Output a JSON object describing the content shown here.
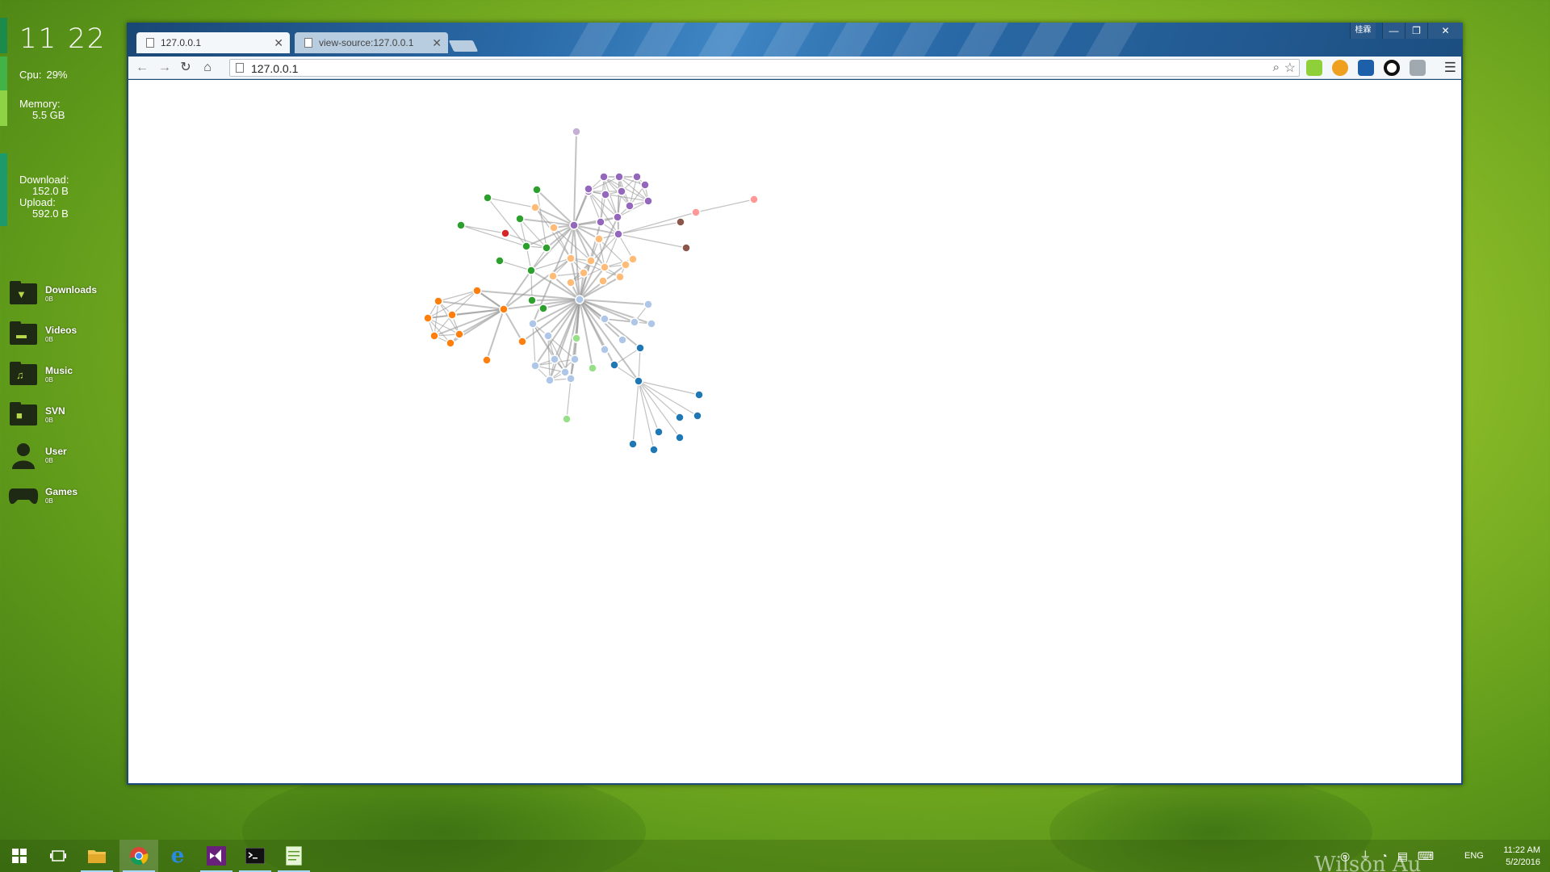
{
  "desktop": {
    "clock": "11 22",
    "cpu_label": "Cpu:",
    "cpu_value": "29%",
    "memory_label": "Memory:",
    "memory_value": "5.5 GB",
    "download_label": "Download:",
    "download_value": "152.0 B",
    "upload_label": "Upload:",
    "upload_value": "592.0 B",
    "shortcuts": [
      {
        "name": "Downloads",
        "size": "0B",
        "icon": "download-folder-icon"
      },
      {
        "name": "Videos",
        "size": "0B",
        "icon": "video-folder-icon"
      },
      {
        "name": "Music",
        "size": "0B",
        "icon": "music-folder-icon"
      },
      {
        "name": "SVN",
        "size": "0B",
        "icon": "svn-folder-icon"
      },
      {
        "name": "User",
        "size": "0B",
        "icon": "user-icon"
      },
      {
        "name": "Games",
        "size": "0B",
        "icon": "gamepad-icon"
      }
    ],
    "watermark": "Wilson Au"
  },
  "browser": {
    "tabs": [
      {
        "title": "127.0.0.1",
        "active": true
      },
      {
        "title": "view-source:127.0.0.1",
        "active": false
      }
    ],
    "user_badge": "桂霖",
    "url": "127.0.0.1"
  },
  "graph": {
    "colors": {
      "blue_dark": "#1f77b4",
      "blue_light": "#aec7e8",
      "orange": "#ff7f0e",
      "orange_light": "#ffbb78",
      "green": "#2ca02c",
      "green_light": "#98df8a",
      "red": "#d62728",
      "pink": "#ff9896",
      "purple": "#9467bd",
      "purple_light": "#c5b0d5",
      "brown": "#8c564b",
      "link": "#999999"
    },
    "nodes": [
      {
        "id": 0,
        "group": "purple_light"
      },
      {
        "id": 1,
        "group": "purple"
      },
      {
        "id": 2,
        "group": "purple"
      },
      {
        "id": 3,
        "group": "purple"
      },
      {
        "id": 4,
        "group": "purple"
      },
      {
        "id": 5,
        "group": "purple"
      },
      {
        "id": 6,
        "group": "purple"
      },
      {
        "id": 7,
        "group": "purple"
      },
      {
        "id": 8,
        "group": "purple"
      },
      {
        "id": 9,
        "group": "purple"
      },
      {
        "id": 10,
        "group": "purple"
      },
      {
        "id": 11,
        "group": "purple"
      },
      {
        "id": 12,
        "group": "purple"
      },
      {
        "id": 13,
        "group": "purple"
      },
      {
        "id": 14,
        "group": "purple"
      },
      {
        "id": 15,
        "group": "pink"
      },
      {
        "id": 16,
        "group": "pink"
      },
      {
        "id": 17,
        "group": "brown"
      },
      {
        "id": 18,
        "group": "brown"
      },
      {
        "id": 19,
        "group": "green"
      },
      {
        "id": 20,
        "group": "green"
      },
      {
        "id": 21,
        "group": "green"
      },
      {
        "id": 22,
        "group": "green"
      },
      {
        "id": 23,
        "group": "green"
      },
      {
        "id": 24,
        "group": "green"
      },
      {
        "id": 25,
        "group": "green"
      },
      {
        "id": 26,
        "group": "green"
      },
      {
        "id": 27,
        "group": "green"
      },
      {
        "id": 28,
        "group": "green"
      },
      {
        "id": 29,
        "group": "red"
      },
      {
        "id": 30,
        "group": "orange_light"
      },
      {
        "id": 31,
        "group": "orange_light"
      },
      {
        "id": 32,
        "group": "orange_light"
      },
      {
        "id": 33,
        "group": "orange_light"
      },
      {
        "id": 34,
        "group": "orange_light"
      },
      {
        "id": 35,
        "group": "orange_light"
      },
      {
        "id": 36,
        "group": "orange_light"
      },
      {
        "id": 37,
        "group": "orange_light"
      },
      {
        "id": 38,
        "group": "orange_light"
      },
      {
        "id": 39,
        "group": "orange_light"
      },
      {
        "id": 40,
        "group": "orange_light"
      },
      {
        "id": 41,
        "group": "orange_light"
      },
      {
        "id": 42,
        "group": "orange_light"
      },
      {
        "id": 43,
        "group": "orange"
      },
      {
        "id": 44,
        "group": "orange"
      },
      {
        "id": 45,
        "group": "orange"
      },
      {
        "id": 46,
        "group": "orange"
      },
      {
        "id": 47,
        "group": "orange"
      },
      {
        "id": 48,
        "group": "orange"
      },
      {
        "id": 49,
        "group": "orange"
      },
      {
        "id": 50,
        "group": "orange"
      },
      {
        "id": 51,
        "group": "orange"
      },
      {
        "id": 52,
        "group": "orange"
      },
      {
        "id": 53,
        "group": "blue_light"
      },
      {
        "id": 54,
        "group": "blue_light"
      },
      {
        "id": 55,
        "group": "blue_light"
      },
      {
        "id": 56,
        "group": "blue_light"
      },
      {
        "id": 57,
        "group": "blue_light"
      },
      {
        "id": 58,
        "group": "blue_light"
      },
      {
        "id": 59,
        "group": "blue_light"
      },
      {
        "id": 60,
        "group": "blue_light"
      },
      {
        "id": 61,
        "group": "blue_light"
      },
      {
        "id": 62,
        "group": "blue_light"
      },
      {
        "id": 63,
        "group": "blue_light"
      },
      {
        "id": 64,
        "group": "blue_light"
      },
      {
        "id": 65,
        "group": "blue_light"
      },
      {
        "id": 66,
        "group": "blue_light"
      },
      {
        "id": 67,
        "group": "blue_light"
      },
      {
        "id": 68,
        "group": "green_light"
      },
      {
        "id": 69,
        "group": "green_light"
      },
      {
        "id": 70,
        "group": "green_light"
      },
      {
        "id": 71,
        "group": "blue_dark"
      },
      {
        "id": 72,
        "group": "blue_dark"
      },
      {
        "id": 73,
        "group": "blue_dark"
      },
      {
        "id": 74,
        "group": "blue_dark"
      },
      {
        "id": 75,
        "group": "blue_dark"
      },
      {
        "id": 76,
        "group": "blue_dark"
      },
      {
        "id": 77,
        "group": "blue_dark"
      },
      {
        "id": 78,
        "group": "blue_dark"
      },
      {
        "id": 79,
        "group": "blue_dark"
      },
      {
        "id": 80,
        "group": "blue_dark"
      }
    ]
  },
  "taskbar": {
    "apps": [
      {
        "name": "start-button",
        "icon": "windows-logo-icon"
      },
      {
        "name": "task-view-button",
        "icon": "task-view-icon"
      },
      {
        "name": "file-explorer-button",
        "icon": "folder-icon"
      },
      {
        "name": "chrome-button",
        "icon": "chrome-icon"
      },
      {
        "name": "edge-button",
        "icon": "edge-icon"
      },
      {
        "name": "visual-studio-button",
        "icon": "visual-studio-icon"
      },
      {
        "name": "terminal-button",
        "icon": "terminal-icon"
      },
      {
        "name": "notepad-button",
        "icon": "notepad-icon"
      }
    ],
    "language": "ENG",
    "time": "11:22 AM",
    "date": "5/2/2016"
  }
}
